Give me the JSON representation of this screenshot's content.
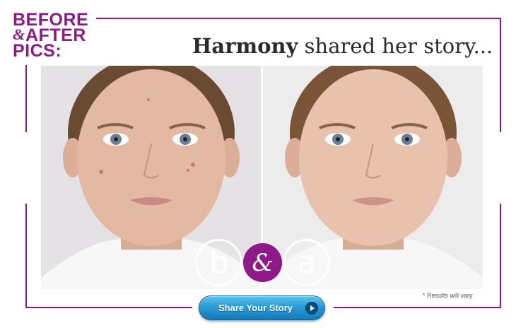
{
  "logo": {
    "line1": "BEFORE",
    "amp": "&",
    "line2": "AFTER",
    "line3": "PICS:"
  },
  "headline": {
    "name": "Harmony",
    "rest": " shared her story..."
  },
  "badges": {
    "before": "b",
    "and": "&",
    "after": "a"
  },
  "disclaimer": "* Results will vary",
  "share_button": {
    "label": "Share Your Story",
    "icon": "play-arrow-icon"
  },
  "colors": {
    "brand_purple": "#8e1a87",
    "button_blue": "#2a9bd6"
  }
}
